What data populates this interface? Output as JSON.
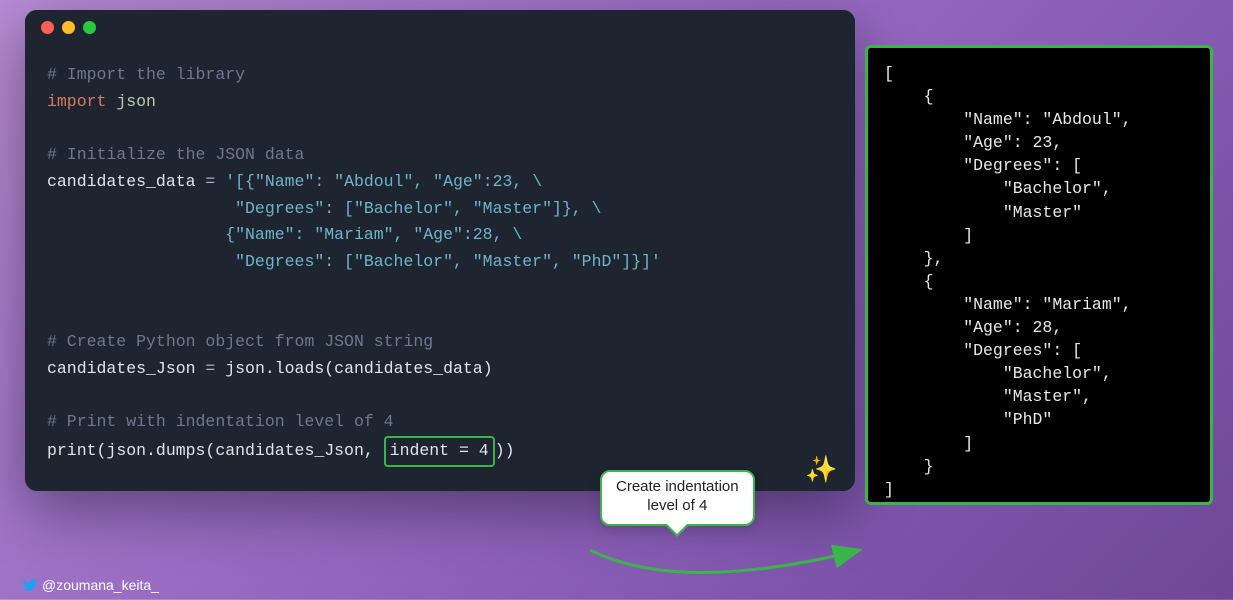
{
  "code": {
    "comment1": "# Import the library",
    "kw_import": "import",
    "mod_json": " json",
    "comment2": "# Initialize the JSON data",
    "var_candidates_data": "candidates_data",
    "eq": " = ",
    "str_line1": "'[{\"Name\": \"Abdoul\", \"Age\":23, \\",
    "str_line2": "                   \"Degrees\": [\"Bachelor\", \"Master\"]}, \\",
    "str_line3": "                  {\"Name\": \"Mariam\", \"Age\":28, \\",
    "str_line4": "                   \"Degrees\": [\"Bachelor\", \"Master\", \"PhD\"]}]'",
    "comment3": "# Create Python object from JSON string",
    "var_candidates_json": "candidates_Json",
    "call_loads": "json.loads(candidates_data)",
    "comment4": "# Print with indentation level of 4",
    "fn_print": "print",
    "call_dumps_pre": "(json.dumps(candidates_Json, ",
    "indent_arg": "indent = 4",
    "call_dumps_post": "))"
  },
  "tooltip": {
    "line1": "Create indentation",
    "line2": "level of 4"
  },
  "sparkle": "✨",
  "output_text": "[\n    {\n        \"Name\": \"Abdoul\",\n        \"Age\": 23,\n        \"Degrees\": [\n            \"Bachelor\",\n            \"Master\"\n        ]\n    },\n    {\n        \"Name\": \"Mariam\",\n        \"Age\": 28,\n        \"Degrees\": [\n            \"Bachelor\",\n            \"Master\",\n            \"PhD\"\n        ]\n    }\n]",
  "handle": "@zoumana_keita_",
  "chart_data": {
    "type": "table",
    "candidates": [
      {
        "Name": "Abdoul",
        "Age": 23,
        "Degrees": [
          "Bachelor",
          "Master"
        ]
      },
      {
        "Name": "Mariam",
        "Age": 28,
        "Degrees": [
          "Bachelor",
          "Master",
          "PhD"
        ]
      }
    ],
    "indent_level": 4
  }
}
